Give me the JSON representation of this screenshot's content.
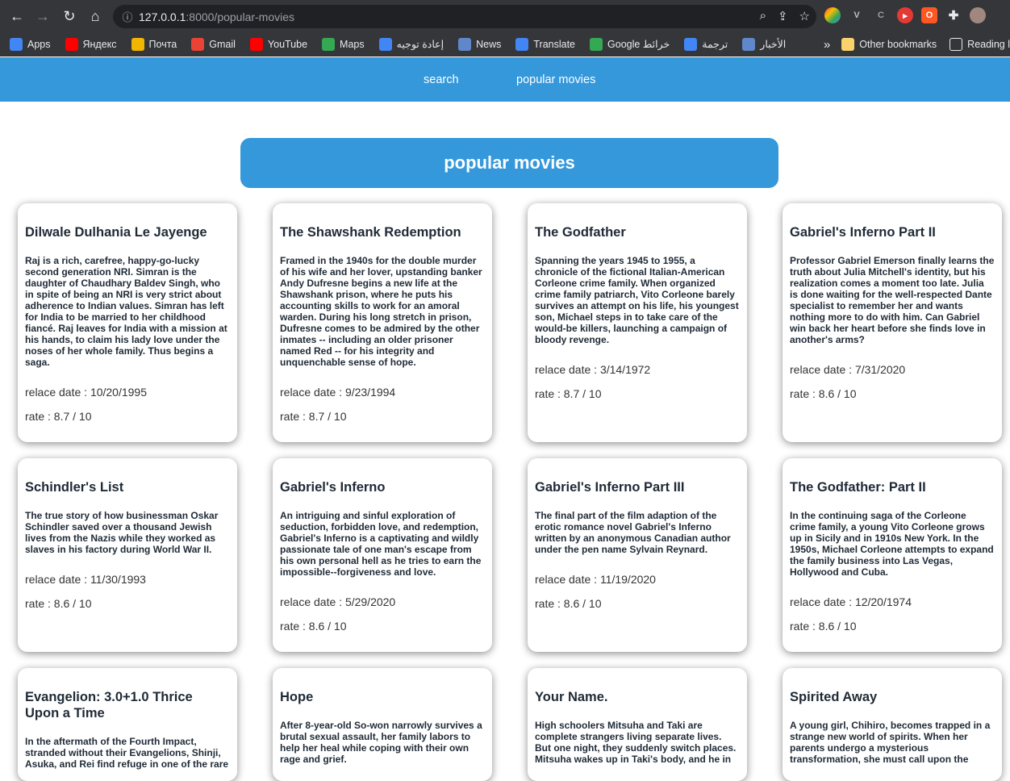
{
  "browser": {
    "url_host": "127.0.0.1",
    "url_rest": ":8000/popular-movies",
    "bookmarks": [
      {
        "label": "Apps",
        "icon": "apps-grid-icon",
        "color": "#4285f4"
      },
      {
        "label": "Яндекс",
        "icon": "yandex-icon",
        "color": "#ff0000"
      },
      {
        "label": "Почта",
        "icon": "mail-icon",
        "color": "#f2b600"
      },
      {
        "label": "Gmail",
        "icon": "gmail-icon",
        "color": "#ea4335"
      },
      {
        "label": "YouTube",
        "icon": "youtube-icon",
        "color": "#ff0000"
      },
      {
        "label": "Maps",
        "icon": "maps-icon",
        "color": "#34a853"
      },
      {
        "label": "إعادة توجيه",
        "icon": "google-icon",
        "color": "#4285f4"
      },
      {
        "label": "News",
        "icon": "news-icon",
        "color": "#5f87c9"
      },
      {
        "label": "Translate",
        "icon": "translate-icon",
        "color": "#4285f4"
      },
      {
        "label": "Google خرائط",
        "icon": "maps-icon",
        "color": "#34a853"
      },
      {
        "label": "ترجمة",
        "icon": "translate-icon",
        "color": "#4285f4"
      },
      {
        "label": "الأخبار",
        "icon": "news-icon",
        "color": "#5f87c9"
      }
    ],
    "more_label": "»",
    "other_bookmarks": "Other bookmarks",
    "reading_list": "Reading l"
  },
  "nav": {
    "search_label": "search",
    "popular_label": "popular movies"
  },
  "page_title": "popular movies",
  "date_prefix": "relace date : ",
  "rate_prefix": "rate : ",
  "movies": [
    {
      "title": "Dilwale Dulhania Le Jayenge",
      "overview": "Raj is a rich, carefree, happy-go-lucky second generation NRI. Simran is the daughter of Chaudhary Baldev Singh, who in spite of being an NRI is very strict about adherence to Indian values. Simran has left for India to be married to her childhood fiancé. Raj leaves for India with a mission at his hands, to claim his lady love under the noses of her whole family. Thus begins a saga.",
      "date": "relace date : 10/20/1995",
      "rate": "rate : 8.7 / 10"
    },
    {
      "title": "The Shawshank Redemption",
      "overview": "Framed in the 1940s for the double murder of his wife and her lover, upstanding banker Andy Dufresne begins a new life at the Shawshank prison, where he puts his accounting skills to work for an amoral warden. During his long stretch in prison, Dufresne comes to be admired by the other inmates -- including an older prisoner named Red -- for his integrity and unquenchable sense of hope.",
      "date": "relace date : 9/23/1994",
      "rate": "rate : 8.7 / 10"
    },
    {
      "title": "The Godfather",
      "overview": "Spanning the years 1945 to 1955, a chronicle of the fictional Italian-American Corleone crime family. When organized crime family patriarch, Vito Corleone barely survives an attempt on his life, his youngest son, Michael steps in to take care of the would-be killers, launching a campaign of bloody revenge.",
      "date": "relace date : 3/14/1972",
      "rate": "rate : 8.7 / 10"
    },
    {
      "title": "Gabriel's Inferno Part II",
      "overview": "Professor Gabriel Emerson finally learns the truth about Julia Mitchell's identity, but his realization comes a moment too late. Julia is done waiting for the well-respected Dante specialist to remember her and wants nothing more to do with him. Can Gabriel win back her heart before she finds love in another's arms?",
      "date": "relace date : 7/31/2020",
      "rate": "rate : 8.6 / 10"
    },
    {
      "title": "Schindler's List",
      "overview": "The true story of how businessman Oskar Schindler saved over a thousand Jewish lives from the Nazis while they worked as slaves in his factory during World War II.",
      "date": "relace date : 11/30/1993",
      "rate": "rate : 8.6 / 10"
    },
    {
      "title": "Gabriel's Inferno",
      "overview": "An intriguing and sinful exploration of seduction, forbidden love, and redemption, Gabriel's Inferno is a captivating and wildly passionate tale of one man's escape from his own personal hell as he tries to earn the impossible--forgiveness and love.",
      "date": "relace date : 5/29/2020",
      "rate": "rate : 8.6 / 10"
    },
    {
      "title": "Gabriel's Inferno Part III",
      "overview": "The final part of the film adaption of the erotic romance novel Gabriel's Inferno written by an anonymous Canadian author under the pen name Sylvain Reynard.",
      "date": "relace date : 11/19/2020",
      "rate": "rate : 8.6 / 10"
    },
    {
      "title": "The Godfather: Part II",
      "overview": "In the continuing saga of the Corleone crime family, a young Vito Corleone grows up in Sicily and in 1910s New York. In the 1950s, Michael Corleone attempts to expand the family business into Las Vegas, Hollywood and Cuba.",
      "date": "relace date : 12/20/1974",
      "rate": "rate : 8.6 / 10"
    },
    {
      "title": "Evangelion: 3.0+1.0 Thrice Upon a Time",
      "overview": "In the aftermath of the Fourth Impact, stranded without their Evangelions, Shinji, Asuka, and Rei find refuge in one of the rare",
      "date": "",
      "rate": ""
    },
    {
      "title": "Hope",
      "overview": "After 8-year-old So-won narrowly survives a brutal sexual assault, her family labors to help her heal while coping with their own rage and grief.",
      "date": "",
      "rate": ""
    },
    {
      "title": "Your Name.",
      "overview": "High schoolers Mitsuha and Taki are complete strangers living separate lives. But one night, they suddenly switch places. Mitsuha wakes up in Taki's body, and he in",
      "date": "",
      "rate": ""
    },
    {
      "title": "Spirited Away",
      "overview": "A young girl, Chihiro, becomes trapped in a strange new world of spirits. When her parents undergo a mysterious transformation, she must call upon the",
      "date": "",
      "rate": ""
    }
  ]
}
